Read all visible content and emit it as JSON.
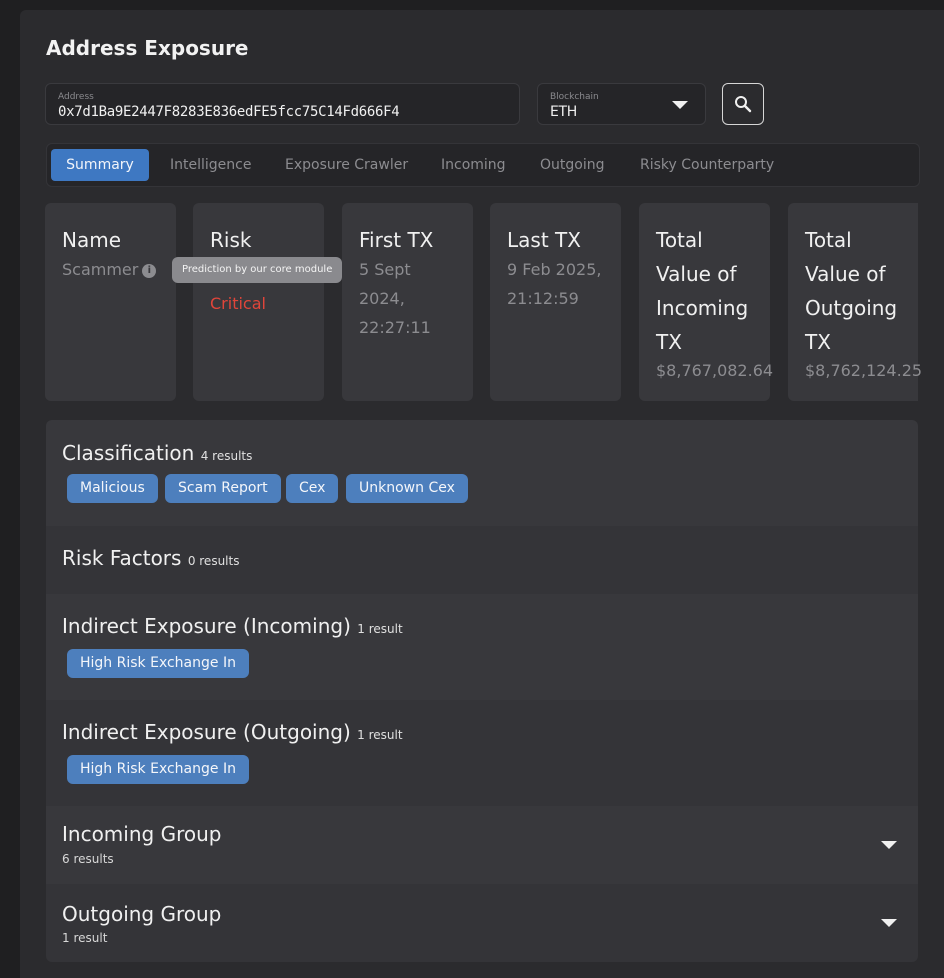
{
  "page": {
    "title": "Address Exposure"
  },
  "search": {
    "address_label": "Address",
    "address_value": "0x7d1Ba9E2447F8283E836edFE5fcc75C14Fd666F4",
    "blockchain_label": "Blockchain",
    "blockchain_value": "ETH",
    "search_icon": "search-icon"
  },
  "tabs": [
    "Summary",
    "Intelligence",
    "Exposure Crawler",
    "Incoming",
    "Outgoing",
    "Risky Counterparty"
  ],
  "active_tab": "Summary",
  "cards": {
    "name": {
      "heading": "Name",
      "value": "Scammer",
      "icon": "info-icon"
    },
    "risk": {
      "heading": "Risk",
      "value": "Critical",
      "tooltip": "Prediction by our core module",
      "color": "#e0453a"
    },
    "first_tx": {
      "heading": "First TX",
      "lines": [
        "5 Sept",
        "2024,",
        "22:27:11"
      ]
    },
    "last_tx": {
      "heading": "Last TX",
      "lines": [
        "9 Feb 2025,",
        "21:12:59"
      ]
    },
    "incoming": {
      "heading_lines": [
        "Total",
        "Value of",
        "Incoming",
        "TX"
      ],
      "value": "$8,767,082.64"
    },
    "outgoing": {
      "heading_lines": [
        "Total",
        "Value of",
        "Outgoing",
        "TX"
      ],
      "value": "$8,762,124.25"
    }
  },
  "sections": {
    "classification": {
      "title": "Classification",
      "count": "4 results",
      "tags": [
        "Malicious",
        "Scam Report",
        "Cex",
        "Unknown Cex"
      ]
    },
    "risk_factors": {
      "title": "Risk Factors",
      "count": "0 results"
    },
    "indirect_in": {
      "title": "Indirect Exposure (Incoming)",
      "count": "1 result",
      "tags": [
        "High Risk Exchange In"
      ]
    },
    "indirect_out": {
      "title": "Indirect Exposure (Outgoing)",
      "count": "1 result",
      "tags": [
        "High Risk Exchange In"
      ]
    },
    "incoming_group": {
      "title": "Incoming Group",
      "count": "6 results",
      "icon": "chevron-down-icon"
    },
    "outgoing_group": {
      "title": "Outgoing Group",
      "count": "1 result",
      "icon": "chevron-down-icon"
    }
  },
  "colors": {
    "accent": "#3e78c2",
    "tag": "#4d7fbd",
    "critical": "#e0453a",
    "panel": "#38383c"
  }
}
